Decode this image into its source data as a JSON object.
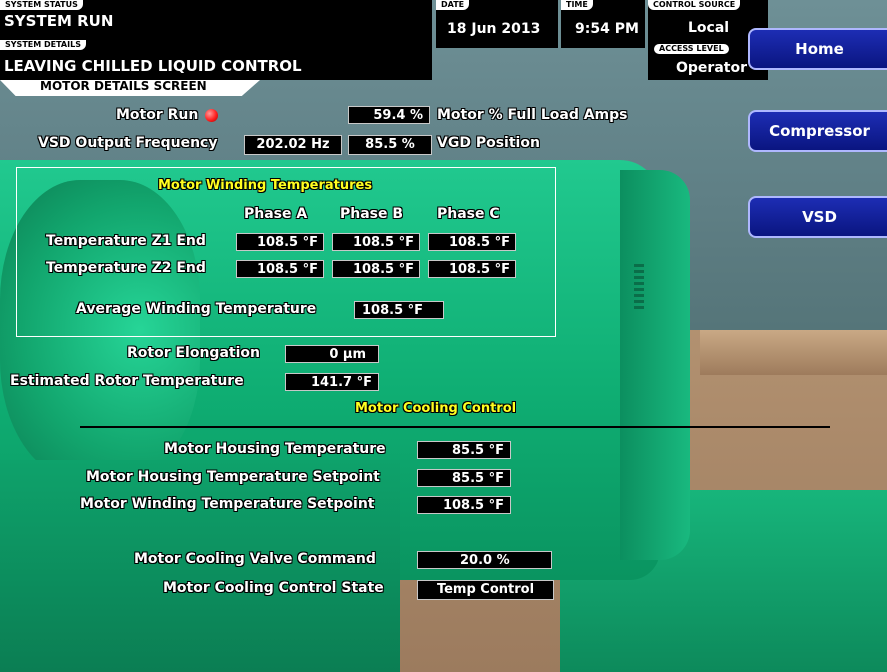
{
  "header": {
    "system_status_tag": "SYSTEM STATUS",
    "system_status": "SYSTEM RUN",
    "system_details_tag": "SYSTEM DETAILS",
    "system_details": "LEAVING CHILLED LIQUID CONTROL",
    "date_tag": "DATE",
    "date": "18 Jun 2013",
    "time_tag": "TIME",
    "time": "9:54 PM",
    "control_source_tag": "CONTROL SOURCE",
    "control_source": "Local",
    "access_level_tag": "ACCESS LEVEL",
    "access_level": "Operator",
    "screen_tab": "MOTOR DETAILS SCREEN"
  },
  "nav": {
    "home": "Home",
    "compressor": "Compressor",
    "vsd": "VSD"
  },
  "top": {
    "motor_run_label": "Motor Run",
    "motor_run_status_color": "#ff2020",
    "fla_value": "59.4 %",
    "fla_label": "Motor % Full Load Amps",
    "vsd_freq_label": "VSD Output Frequency",
    "vsd_freq_value": "202.02 Hz",
    "vgd_value": "85.5 %",
    "vgd_label": "VGD Position"
  },
  "winding": {
    "title": "Motor Winding Temperatures",
    "phase_headers": [
      "Phase A",
      "Phase B",
      "Phase C"
    ],
    "rows": [
      {
        "label": "Temperature Z1 End",
        "values": [
          "108.5 °F",
          "108.5 °F",
          "108.5 °F"
        ]
      },
      {
        "label": "Temperature Z2 End",
        "values": [
          "108.5 °F",
          "108.5 °F",
          "108.5 °F"
        ]
      }
    ],
    "avg_label": "Average Winding Temperature",
    "avg_value": "108.5 °F"
  },
  "rotor": {
    "elongation_label": "Rotor Elongation",
    "elongation_value": "0 µm",
    "est_temp_label": "Estimated Rotor Temperature",
    "est_temp_value": "141.7 °F"
  },
  "cooling": {
    "title": "Motor Cooling Control",
    "housing_temp_label": "Motor Housing Temperature",
    "housing_temp_value": "85.5 °F",
    "housing_setpoint_label": "Motor Housing Temperature Setpoint",
    "housing_setpoint_value": "85.5 °F",
    "winding_setpoint_label": "Motor Winding Temperature Setpoint",
    "winding_setpoint_value": "108.5 °F",
    "valve_cmd_label": "Motor Cooling Valve Command",
    "valve_cmd_value": "20.0 %",
    "state_label": "Motor Cooling Control State",
    "state_value": "Temp Control"
  }
}
